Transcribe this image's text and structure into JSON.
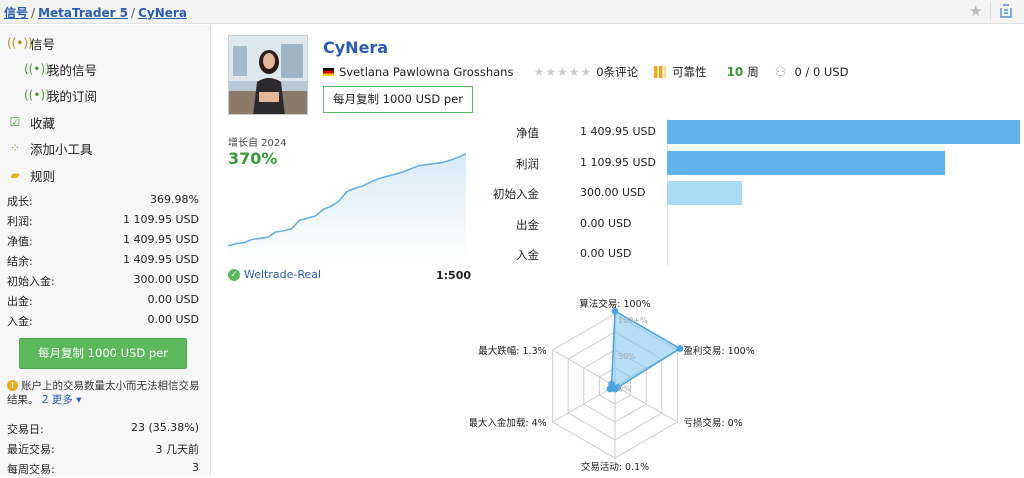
{
  "breadcrumb": {
    "root": "信号",
    "platform": "MetaTrader 5",
    "current": "CyNera"
  },
  "sidebar": {
    "nav": [
      {
        "label": "信号",
        "icon": "signal-icon"
      },
      {
        "label": "我的信号",
        "icon": "my-signal-icon"
      },
      {
        "label": "我的订阅",
        "icon": "subscription-icon"
      },
      {
        "label": "收藏",
        "icon": "favorite-icon"
      },
      {
        "label": "添加小工具",
        "icon": "widget-icon"
      },
      {
        "label": "规则",
        "icon": "rules-icon"
      }
    ],
    "stats": [
      {
        "label": "成长:",
        "value": "369.98%"
      },
      {
        "label": "利润:",
        "value": "1 109.95 USD"
      },
      {
        "label": "净值:",
        "value": "1 409.95 USD"
      },
      {
        "label": "结余:",
        "value": "1 409.95 USD"
      },
      {
        "label": "初始入金:",
        "value": "300.00 USD"
      },
      {
        "label": "出金:",
        "value": "0.00 USD"
      },
      {
        "label": "入金:",
        "value": "0.00 USD"
      }
    ],
    "copy_button": "每月复制 1000 USD per",
    "warning_text": "账户上的交易数量太小而无法相信交易结果。",
    "more_link": "2 更多",
    "stats2": [
      {
        "label": "交易日:",
        "value": "23 (35.38%)"
      },
      {
        "label": "最近交易:",
        "value": "3 几天前"
      },
      {
        "label": "每周交易:",
        "value": "3"
      }
    ]
  },
  "signal": {
    "name": "CyNera",
    "author": "Svetlana Pawlowna Grosshans",
    "reviews": "0条评论",
    "reliability": "可靠性",
    "weeks_num": "10",
    "weeks_unit": "周",
    "subscribers": "0 / 0 USD",
    "copy_button": "每月复制 1000 USD per"
  },
  "growth": {
    "label": "增长自 2024",
    "value": "370%",
    "broker": "Weltrade-Real",
    "leverage": "1:500",
    "line_color": "#6aaee0",
    "points": [
      2,
      4,
      5,
      8,
      9,
      10,
      15,
      16,
      18,
      26,
      28,
      30,
      36,
      39,
      44,
      53,
      56,
      58,
      62,
      65,
      67,
      69,
      71,
      74,
      77,
      78,
      79,
      80,
      82,
      85,
      88
    ]
  },
  "bars": {
    "max": 1409.95,
    "items": [
      {
        "label": "净值",
        "value_text": "1 409.95 USD",
        "value": 1409.95,
        "color": "#5fb2e9"
      },
      {
        "label": "利润",
        "value_text": "1 109.95 USD",
        "value": 1109.95,
        "color": "#5fb2e9"
      },
      {
        "label": "初始入金",
        "value_text": "300.00 USD",
        "value": 300,
        "color": "#a9dbf3"
      },
      {
        "label": "出金",
        "value_text": "0.00 USD",
        "value": 0,
        "color": "#5fb2e9"
      },
      {
        "label": "入金",
        "value_text": "0.00 USD",
        "value": 0,
        "color": "#5fb2e9"
      }
    ]
  },
  "radar": {
    "ring_labels": [
      "100+%",
      "50%",
      "0%"
    ],
    "axes": [
      {
        "label": "算法交易: 100%",
        "value": 1.0
      },
      {
        "label": "盈利交易: 100%",
        "value": 1.0
      },
      {
        "label": "亏损交易: 0%",
        "value": 0.0
      },
      {
        "label": "交易活动: 0.1%",
        "value": 0.001
      },
      {
        "label": "最大入金加载: 4%",
        "value": 0.04
      },
      {
        "label": "最大跌幅: 1.3%",
        "value": 0.013
      }
    ],
    "fill_color": "#7cc3ee"
  }
}
